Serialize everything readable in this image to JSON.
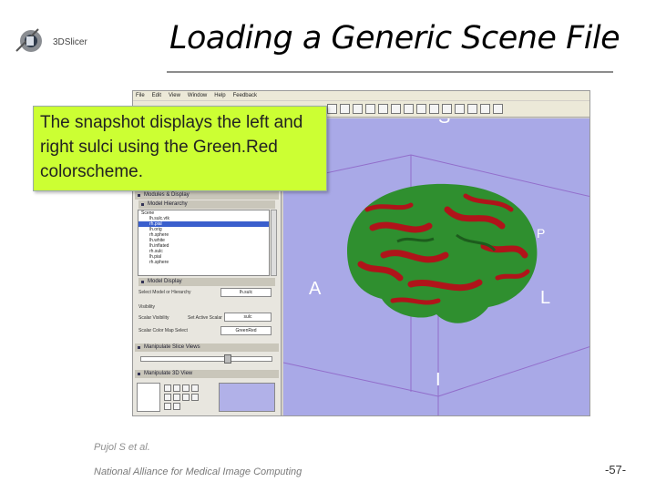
{
  "header": {
    "logo_text": "3DSlicer",
    "title": "Loading a Generic Scene File"
  },
  "callout": {
    "text": "The snapshot displays the left and right sulci using the Green.Red colorscheme."
  },
  "app": {
    "menu": [
      "File",
      "Edit",
      "View",
      "Window",
      "Help",
      "Feedback"
    ],
    "panels": {
      "models": "Modules & Display",
      "hierarchy": "Model Hierarchy",
      "model_display": "Model Display",
      "slice_views": "Manipulate Slice Views",
      "view_3d": "Manipulate 3D View"
    },
    "tree_items": [
      "Scene",
      "lh.sulc.vtk",
      "rh.pial",
      "lh.orig",
      "rh.sphere",
      "lh.white",
      "lh.inflated",
      "rh.sulc",
      "lh.pial",
      "rh.sphere"
    ],
    "controls": {
      "select_model_label": "Select Model or Hierarchy",
      "select_model_value": "lh.sulc",
      "visibility_label": "Visibility",
      "scalar_visibility_label": "Scalar Visibility",
      "active_scalar_label": "Set Active Scalar",
      "active_scalar_value": "sulc",
      "color_map_label": "Scalar Color Map Select",
      "color_map_value": "GreenRed"
    },
    "viewer": {
      "labels": {
        "s": "S",
        "a": "A",
        "l": "L",
        "p": "P",
        "i": "I"
      },
      "background_color": "#a9a9e7",
      "colorscheme": "GreenRed"
    }
  },
  "footer": {
    "author": "Pujol S et al.",
    "organization": "National Alliance for Medical Image Computing",
    "page": "-57-"
  },
  "colors": {
    "callout_bg": "#ccff33",
    "brain_green": "#2f8f2f",
    "brain_red": "#b0141a"
  }
}
